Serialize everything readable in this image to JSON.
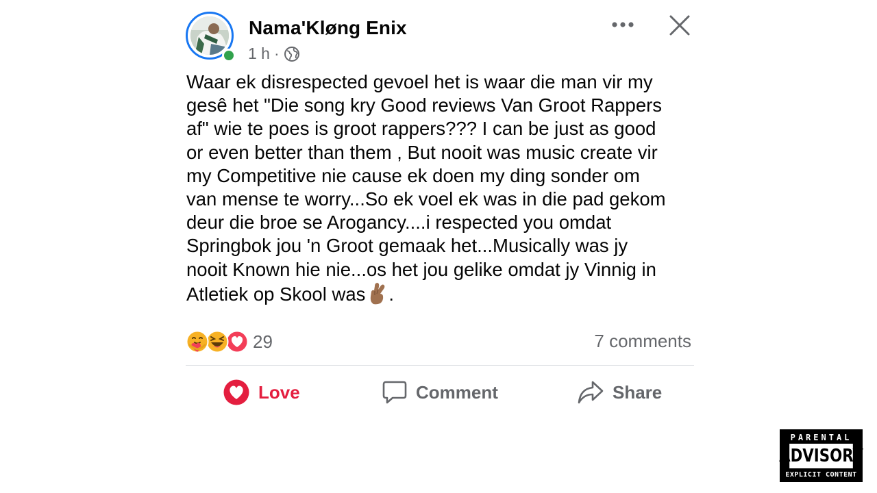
{
  "post": {
    "author": "Nama'Kløng Enix",
    "time": "1 h",
    "separator": "·",
    "audience_icon": "globe-icon",
    "text": "Waar ek disrespected gevoel het is waar die man vir my\ngesê het \"Die song kry Good reviews Van Groot Rappers\naf\" wie te poes is groot rappers??? I can be just as good\nor even better than them , But nooit was music create vir\nmy Competitive nie cause ek doen my ding sonder om\nvan mense te worry...So ek voel ek was in die pad gekom\ndeur die broe se Arogancy....i respected you omdat\nSpringbok jou 'n Groot gemaak het...Musically was jy\nnooit Known hie nie...os het jou gelike omdat jy Vinnig in\nAtletiek op Skool was",
    "text_end_emoji": "crossed-fingers-emoji",
    "text_end": ".",
    "reactions": {
      "icons": [
        "care-reaction-icon",
        "haha-reaction-icon",
        "love-reaction-icon"
      ],
      "count": "29"
    },
    "comments": "7 comments"
  },
  "actions": {
    "love": "Love",
    "comment": "Comment",
    "share": "Share"
  },
  "advisory": {
    "top": "PARENTAL",
    "middle": "ADVISORY",
    "bottom": "EXPLICIT CONTENT"
  },
  "colors": {
    "love_red": "#e41e3f",
    "meta_gray": "#65676b",
    "facebook_blue": "#1877f2",
    "online_green": "#31a24c"
  }
}
